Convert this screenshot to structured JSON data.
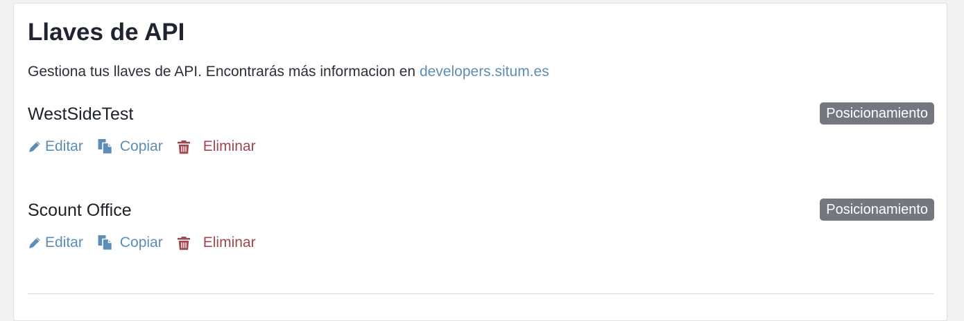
{
  "page": {
    "title": "Llaves de API",
    "description": "Gestiona tus llaves de API. Encontrarás más informacion en ",
    "link_text": "developers.situm.es"
  },
  "keys": [
    {
      "name": "WestSideTest",
      "badge": "Posicionamiento"
    },
    {
      "name": "Scount Office",
      "badge": "Posicionamiento"
    }
  ],
  "actions": {
    "edit": "Editar",
    "copy": "Copiar",
    "delete": "Eliminar"
  },
  "icons": {
    "edit": "pencil-icon",
    "copy": "copy-icon",
    "delete": "trash-icon"
  },
  "colors": {
    "link": "#5b8db6",
    "danger": "#a0474f",
    "badge": "#737880"
  }
}
